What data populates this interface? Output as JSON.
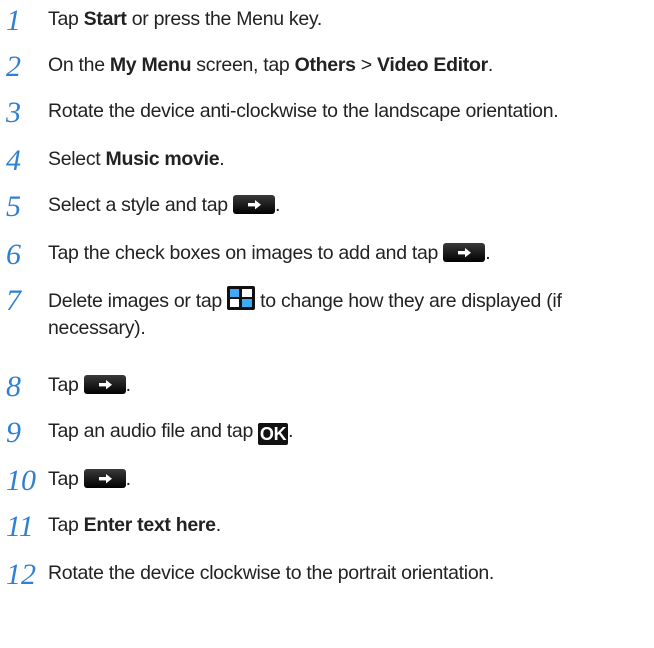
{
  "steps": [
    {
      "n": "1",
      "parts": [
        {
          "t": "Tap "
        },
        {
          "t": "Start",
          "b": true
        },
        {
          "t": " or press the Menu key."
        }
      ]
    },
    {
      "n": "2",
      "parts": [
        {
          "t": "On the "
        },
        {
          "t": "My Menu",
          "b": true
        },
        {
          "t": " screen, tap "
        },
        {
          "t": "Others",
          "b": true
        },
        {
          "t": " > "
        },
        {
          "t": "Video Editor",
          "b": true
        },
        {
          "t": "."
        }
      ]
    },
    {
      "n": "3",
      "parts": [
        {
          "t": "Rotate the device anti-clockwise to the landscape orientation."
        }
      ]
    },
    {
      "n": "4",
      "parts": [
        {
          "t": "Select "
        },
        {
          "t": "Music movie",
          "b": true
        },
        {
          "t": "."
        }
      ]
    },
    {
      "n": "5",
      "parts": [
        {
          "t": "Select a style and tap "
        },
        {
          "icon": "next-arrow-icon"
        },
        {
          "t": "."
        }
      ]
    },
    {
      "n": "6",
      "parts": [
        {
          "t": "Tap the check boxes on images to add and tap "
        },
        {
          "icon": "next-arrow-icon"
        },
        {
          "t": "."
        }
      ]
    },
    {
      "n": "7",
      "parts": [
        {
          "t": "Delete images or tap "
        },
        {
          "icon": "view-grid-icon"
        },
        {
          "t": " to change how they are displayed (if necessary)."
        }
      ]
    },
    {
      "n": "8",
      "parts": [
        {
          "t": "Tap "
        },
        {
          "icon": "next-arrow-icon"
        },
        {
          "t": "."
        }
      ]
    },
    {
      "n": "9",
      "parts": [
        {
          "t": "Tap an audio file and tap "
        },
        {
          "icon": "ok-icon",
          "label": "OK"
        },
        {
          "t": "."
        }
      ]
    },
    {
      "n": "10",
      "parts": [
        {
          "t": "Tap "
        },
        {
          "icon": "next-arrow-icon"
        },
        {
          "t": "."
        }
      ]
    },
    {
      "n": "11",
      "parts": [
        {
          "t": "Tap "
        },
        {
          "t": "Enter text here",
          "b": true
        },
        {
          "t": "."
        }
      ]
    },
    {
      "n": "12",
      "parts": [
        {
          "t": "Rotate the device clockwise to the portrait orientation."
        }
      ]
    }
  ],
  "colors": {
    "step_number": "#2f80d0",
    "text": "#222222",
    "icon_bg": "#000000",
    "grid_accent": "#3fa9f5"
  }
}
